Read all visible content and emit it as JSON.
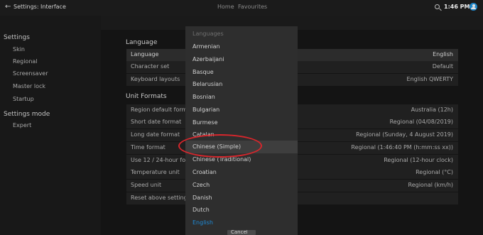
{
  "topbar": {
    "back_glyph": "←",
    "title": "Settings: Interface",
    "nav": [
      "Home",
      "Favourites"
    ],
    "time": "1:46 PM"
  },
  "sidebar": {
    "groups": [
      {
        "title": "Settings",
        "items": [
          "Skin",
          "Regional",
          "Screensaver",
          "Master lock",
          "Startup"
        ]
      },
      {
        "title": "Settings mode",
        "items": [
          "Expert"
        ]
      }
    ]
  },
  "main": {
    "sections": [
      {
        "title": "Language",
        "rows": [
          {
            "label": "Language",
            "value": "English"
          },
          {
            "label": "Character set",
            "value": "Default"
          },
          {
            "label": "Keyboard layouts",
            "value": "English QWERTY"
          }
        ]
      },
      {
        "title": "Unit Formats",
        "rows": [
          {
            "label": "Region default format",
            "value": "Australia (12h)"
          },
          {
            "label": "Short date format",
            "value": "Regional (04/08/2019)"
          },
          {
            "label": "Long date format",
            "value": "Regional (Sunday, 4 August 2019)"
          },
          {
            "label": "Time format",
            "value": "Regional (1:46:40 PM (h:mm:ss xx))"
          },
          {
            "label": "Use 12 / 24-hour format",
            "value": "Regional (12-hour clock)"
          },
          {
            "label": "Temperature unit",
            "value": "Regional (°C)"
          },
          {
            "label": "Speed unit",
            "value": "Regional (km/h)"
          },
          {
            "label": "Reset above settings to default",
            "value": ""
          }
        ]
      }
    ]
  },
  "dialog": {
    "title": "Languages",
    "options": [
      "Armenian",
      "Azerbaijani",
      "Basque",
      "Belarusian",
      "Bosnian",
      "Bulgarian",
      "Burmese",
      "Catalan",
      "Chinese (Simple)",
      "Chinese (Traditional)",
      "Croatian",
      "Czech",
      "Danish",
      "Dutch",
      "English"
    ],
    "focused": "Chinese (Simple)",
    "selected": "English",
    "cancel_label": "Cancel"
  },
  "colors": {
    "accent": "#1e8ad6",
    "annotation": "#d7262c",
    "background": "#141414",
    "dialog": "#2e2e2e"
  },
  "icons": [
    "back-arrow-icon",
    "search-icon",
    "user-avatar-icon"
  ]
}
